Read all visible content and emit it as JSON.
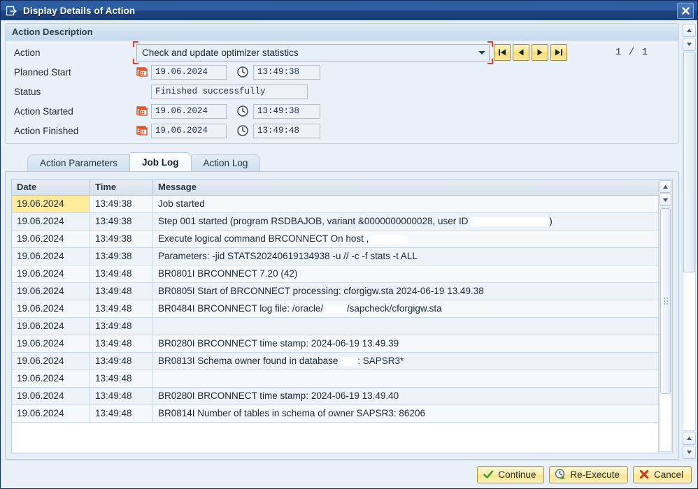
{
  "window": {
    "title": "Display Details of Action",
    "title_icon": "exit-box-icon",
    "close_icon": "close-icon"
  },
  "panel": {
    "header": "Action Description",
    "action": {
      "label": "Action",
      "value": "Check and update optimizer statistics",
      "dropdown_icon": "chevron-down-icon",
      "required": true
    },
    "nav_buttons": [
      {
        "name": "first",
        "label": "|◀",
        "icon": "first-page-icon"
      },
      {
        "name": "previous",
        "label": "◀",
        "icon": "previous-page-icon"
      },
      {
        "name": "next",
        "label": "▶",
        "icon": "next-page-icon"
      },
      {
        "name": "last",
        "label": "▶|",
        "icon": "last-page-icon"
      }
    ],
    "page_counter": "1 / 1",
    "rows": [
      {
        "label": "Planned Start",
        "date": "19.06.2024",
        "time": "13:49:38",
        "has_date": true,
        "has_time": true
      },
      {
        "label": "Status",
        "status": "Finished successfully",
        "has_date": false,
        "has_time": false
      },
      {
        "label": "Action Started",
        "date": "19.06.2024",
        "time": "13:49:38",
        "has_date": true,
        "has_time": true
      },
      {
        "label": "Action Finished",
        "date": "19.06.2024",
        "time": "13:49:48",
        "has_date": true,
        "has_time": true
      }
    ]
  },
  "tabs": [
    {
      "label": "Action Parameters",
      "active": false
    },
    {
      "label": "Job Log",
      "active": true
    },
    {
      "label": "Action Log",
      "active": false
    }
  ],
  "grid": {
    "columns": [
      "Date",
      "Time",
      "Message"
    ],
    "selected_row": 0,
    "rows": [
      {
        "date": "19.06.2024",
        "time": "13:49:38",
        "message": "Job started"
      },
      {
        "date": "19.06.2024",
        "time": "13:49:38",
        "message": "Step 001 started (program RSDBAJOB, variant &0000000000028, user ID",
        "redact_after": 112,
        "message_tail": ")"
      },
      {
        "date": "19.06.2024",
        "time": "13:49:38",
        "message": "Execute logical command BRCONNECT On host ,",
        "redact_after": 52,
        "message_tail": ""
      },
      {
        "date": "19.06.2024",
        "time": "13:49:38",
        "message": "Parameters: -jid STATS20240619134938 -u // -c -f stats -t ALL"
      },
      {
        "date": "19.06.2024",
        "time": "13:49:48",
        "message": "BR0801I BRCONNECT 7.20 (42)"
      },
      {
        "date": "19.06.2024",
        "time": "13:49:48",
        "message": "BR0805I Start of BRCONNECT processing: cforgigw.sta 2024-06-19 13.49.38"
      },
      {
        "date": "19.06.2024",
        "time": "13:49:48",
        "message": "BR0484I BRCONNECT log file: /oracle/",
        "redact_after": 30,
        "message_tail": "/sapcheck/cforgigw.sta"
      },
      {
        "date": "19.06.2024",
        "time": "13:49:48",
        "message": ""
      },
      {
        "date": "19.06.2024",
        "time": "13:49:48",
        "message": "BR0280I BRCONNECT time stamp: 2024-06-19 13.49.39"
      },
      {
        "date": "19.06.2024",
        "time": "13:49:48",
        "message": "BR0813I Schema owner found in database",
        "redact_after": 24,
        "message_tail": ": SAPSR3*"
      },
      {
        "date": "19.06.2024",
        "time": "13:49:48",
        "message": ""
      },
      {
        "date": "19.06.2024",
        "time": "13:49:48",
        "message": "BR0280I BRCONNECT time stamp: 2024-06-19 13.49.40"
      },
      {
        "date": "19.06.2024",
        "time": "13:49:48",
        "message": "BR0814I Number of tables in schema of owner SAPSR3: 86206"
      }
    ]
  },
  "footer": {
    "buttons": [
      {
        "label": "Continue",
        "icon": "check-icon"
      },
      {
        "label": "Re-Execute",
        "icon": "clock-refresh-icon"
      },
      {
        "label": "Cancel",
        "icon": "x-icon"
      }
    ]
  },
  "colors": {
    "titlebar": "#2d5ea2",
    "accent_yellow": "#f8e48a",
    "selection": "#ffeb9c",
    "required_marker": "#e03c2f",
    "panel_bg": "#eaf1f8"
  }
}
